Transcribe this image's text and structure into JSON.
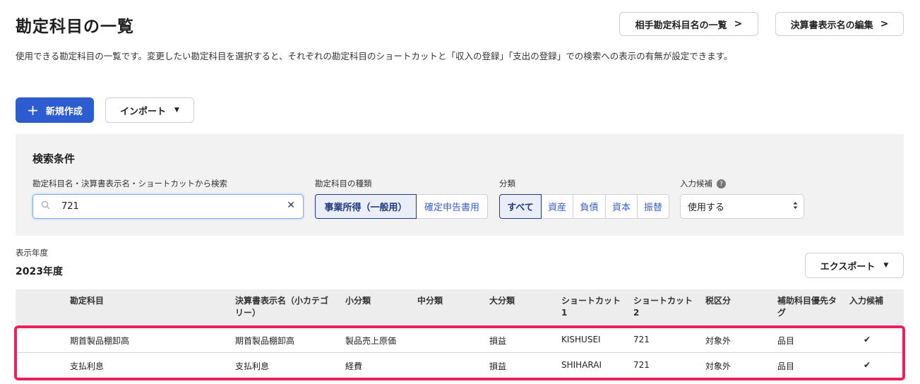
{
  "page": {
    "title": "勘定科目の一覧",
    "description": "使用できる勘定科目の一覧です。変更したい勘定科目を選択すると、それぞれの勘定科目のショートカットと「収入の登録」「支出の登録」での検索への表示の有無が設定できます。"
  },
  "header_buttons": {
    "partner_list": "相手勘定科目名の一覧",
    "edit_display_name": "決算書表示名の編集"
  },
  "actions": {
    "new_label": "新規作成",
    "import_label": "インポート",
    "export_label": "エクスポート"
  },
  "search": {
    "title": "検索条件",
    "keyword_label": "勘定科目名・決算書表示名・ショートカットから検索",
    "keyword_value": "721",
    "type_label": "勘定科目の種類",
    "type_options": [
      "事業所得（一般用）",
      "確定申告書用"
    ],
    "type_selected": "事業所得（一般用）",
    "category_label": "分類",
    "category_options": [
      "すべて",
      "資産",
      "負債",
      "資本",
      "振替"
    ],
    "category_selected": "すべて",
    "input_candidate_label": "入力候補",
    "input_candidate_value": "使用する"
  },
  "year": {
    "label": "表示年度",
    "value": "2023年度"
  },
  "table": {
    "headers": {
      "account": "勘定科目",
      "display_name": "決算書表示名（小カテゴリー）",
      "small": "小分類",
      "medium": "中分類",
      "large": "大分類",
      "shortcut1": "ショートカット1",
      "shortcut2": "ショートカット2",
      "tax": "税区分",
      "tag": "補助科目優先タグ",
      "candidate": "入力候補"
    },
    "rows": [
      {
        "account": "期首製品棚卸高",
        "display_name": "期首製品棚卸高",
        "small": "製品売上原価",
        "medium": "",
        "large": "損益",
        "shortcut1": "KISHUSEI",
        "shortcut2": "721",
        "tax": "対象外",
        "tag": "品目",
        "candidate": "✔"
      },
      {
        "account": "支払利息",
        "display_name": "支払利息",
        "small": "経費",
        "medium": "",
        "large": "損益",
        "shortcut1": "SHIHARAI",
        "shortcut2": "721",
        "tax": "対象外",
        "tag": "品目",
        "candidate": "✔"
      }
    ]
  },
  "icons": {
    "chevron": "›",
    "plus": "+",
    "caret": "▼",
    "search": "⚲",
    "clear": "✕",
    "help": "?"
  },
  "colors": {
    "primary": "#2d5cd0",
    "highlight": "#ef1f5d"
  }
}
